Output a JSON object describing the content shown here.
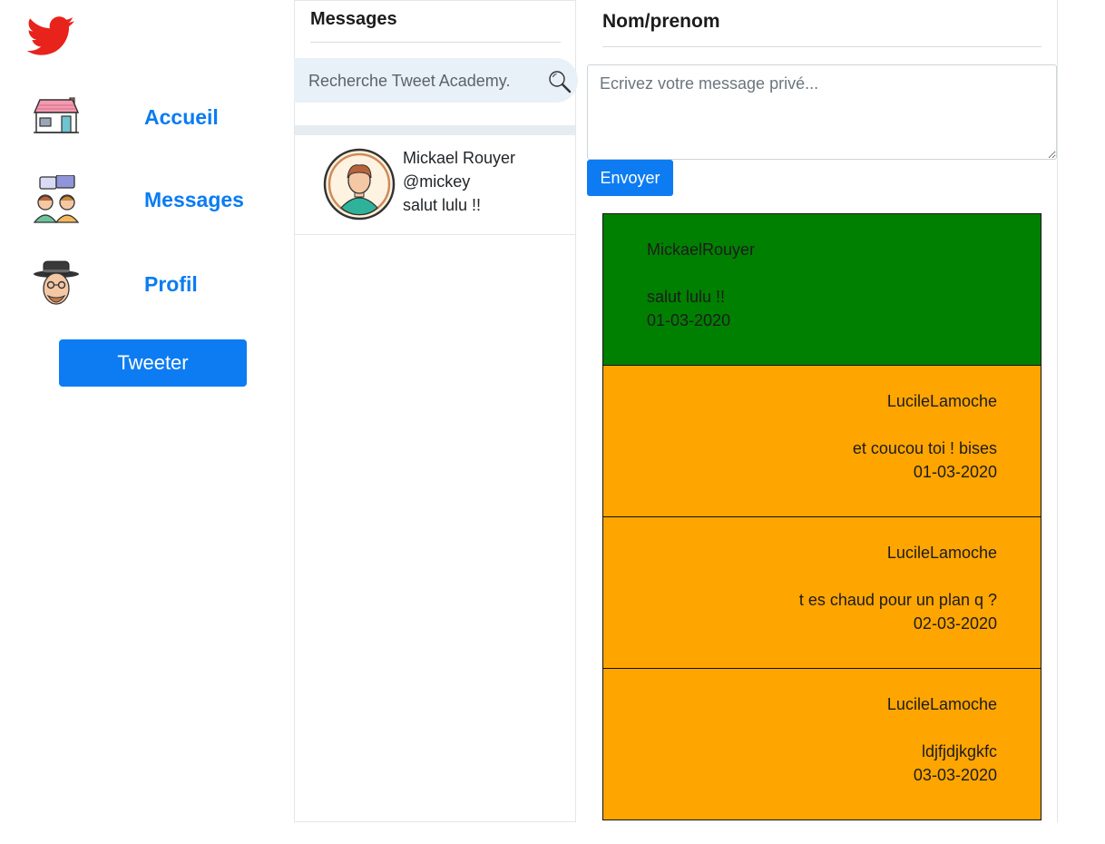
{
  "sidebar": {
    "logo": "twitter-bird-icon",
    "nav": [
      {
        "label": "Accueil",
        "icon": "house-icon"
      },
      {
        "label": "Messages",
        "icon": "chat-people-icon"
      },
      {
        "label": "Profil",
        "icon": "profile-avatar-icon"
      }
    ],
    "tweet_button": "Tweeter"
  },
  "conversations": {
    "title": "Messages",
    "search_placeholder": "Recherche Tweet Academy.",
    "items": [
      {
        "name": "Mickael Rouyer",
        "handle": "@mickey",
        "last_message": "salut lulu !!"
      }
    ]
  },
  "chat": {
    "title": "Nom/prenom",
    "input_placeholder": "Ecrivez votre message privé...",
    "send_label": "Envoyer",
    "messages": [
      {
        "author": "MickaelRouyer",
        "text": "salut lulu !!",
        "date": "01-03-2020",
        "direction": "sent"
      },
      {
        "author": "LucileLamoche",
        "text": "et coucou toi ! bises",
        "date": "01-03-2020",
        "direction": "received"
      },
      {
        "author": "LucileLamoche",
        "text": "t es chaud pour un plan q ?",
        "date": "02-03-2020",
        "direction": "received"
      },
      {
        "author": "LucileLamoche",
        "text": "ldjfjdjkgkfc",
        "date": "03-03-2020",
        "direction": "received"
      }
    ]
  },
  "colors": {
    "accent": "#0d7cf2",
    "sent_bubble": "#008000",
    "received_bubble": "#ffa500",
    "twitter_logo": "#e8231c"
  }
}
